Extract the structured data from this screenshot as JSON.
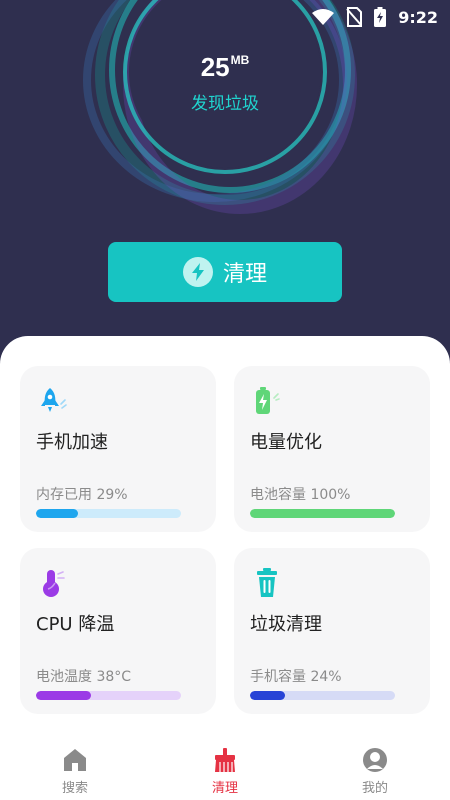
{
  "status_bar": {
    "time": "9:22"
  },
  "hero": {
    "size_value": "25",
    "size_unit": "MB",
    "label": "发现垃圾"
  },
  "clean_button": {
    "label": "清理"
  },
  "cards": [
    {
      "title": "手机加速",
      "subtitle": "内存已用 29%",
      "progress": 0.29,
      "icon": "rocket-icon",
      "bar_color": "#1ea6ee",
      "track_color": "#cdebfb"
    },
    {
      "title": "电量优化",
      "subtitle": "电池容量 100%",
      "progress": 1.0,
      "icon": "battery-icon",
      "bar_color": "#5fd678",
      "track_color": "#d9f5df"
    },
    {
      "title": "CPU 降温",
      "subtitle": "电池温度 38°C",
      "progress": 0.38,
      "icon": "thermometer-icon",
      "bar_color": "#9b3be6",
      "track_color": "#e5d2fa"
    },
    {
      "title": "垃圾清理",
      "subtitle": "手机容量 24%",
      "progress": 0.24,
      "icon": "trash-icon",
      "bar_color": "#2743d6",
      "track_color": "#d6dbf6"
    }
  ],
  "nav": {
    "items": [
      {
        "label": "搜索",
        "icon": "home-icon"
      },
      {
        "label": "清理",
        "icon": "broom-icon"
      },
      {
        "label": "我的",
        "icon": "profile-icon"
      }
    ],
    "active_index": 1
  },
  "colors": {
    "accent": "#17c4c2",
    "background": "#2f2f4f",
    "nav_active": "#e53243"
  }
}
